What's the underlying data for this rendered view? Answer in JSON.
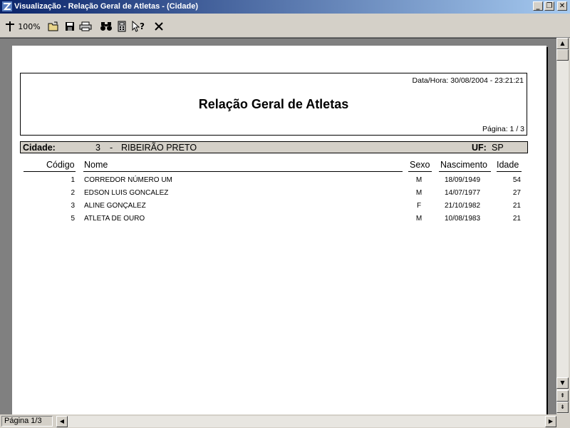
{
  "window": {
    "title": "Visualização - Relação Geral de Atletas - (Cidade)"
  },
  "toolbar": {
    "zoom_label": "100%"
  },
  "report": {
    "datetime": "Data/Hora: 30/08/2004 - 23:21:21",
    "title": "Relação Geral de Atletas",
    "page": "Página: 1 / 3",
    "city_label": "Cidade:",
    "city_code": "3",
    "city_sep": "-",
    "city_name": "RIBEIRÃO PRETO",
    "uf_label": "UF:",
    "uf_value": "SP",
    "columns": {
      "codigo": "Código",
      "nome": "Nome",
      "sexo": "Sexo",
      "nascimento": "Nascimento",
      "idade": "Idade"
    },
    "rows": [
      {
        "codigo": "1",
        "nome": "CORREDOR NÚMERO UM",
        "sexo": "M",
        "nascimento": "18/09/1949",
        "idade": "54"
      },
      {
        "codigo": "2",
        "nome": "EDSON LUIS GONCALEZ",
        "sexo": "M",
        "nascimento": "14/07/1977",
        "idade": "27"
      },
      {
        "codigo": "3",
        "nome": "ALINE GONÇALEZ",
        "sexo": "F",
        "nascimento": "21/10/1982",
        "idade": "21"
      },
      {
        "codigo": "5",
        "nome": "ATLETA DE OURO",
        "sexo": "M",
        "nascimento": "10/08/1983",
        "idade": "21"
      }
    ]
  },
  "status": {
    "page_text": "Página 1/3"
  }
}
